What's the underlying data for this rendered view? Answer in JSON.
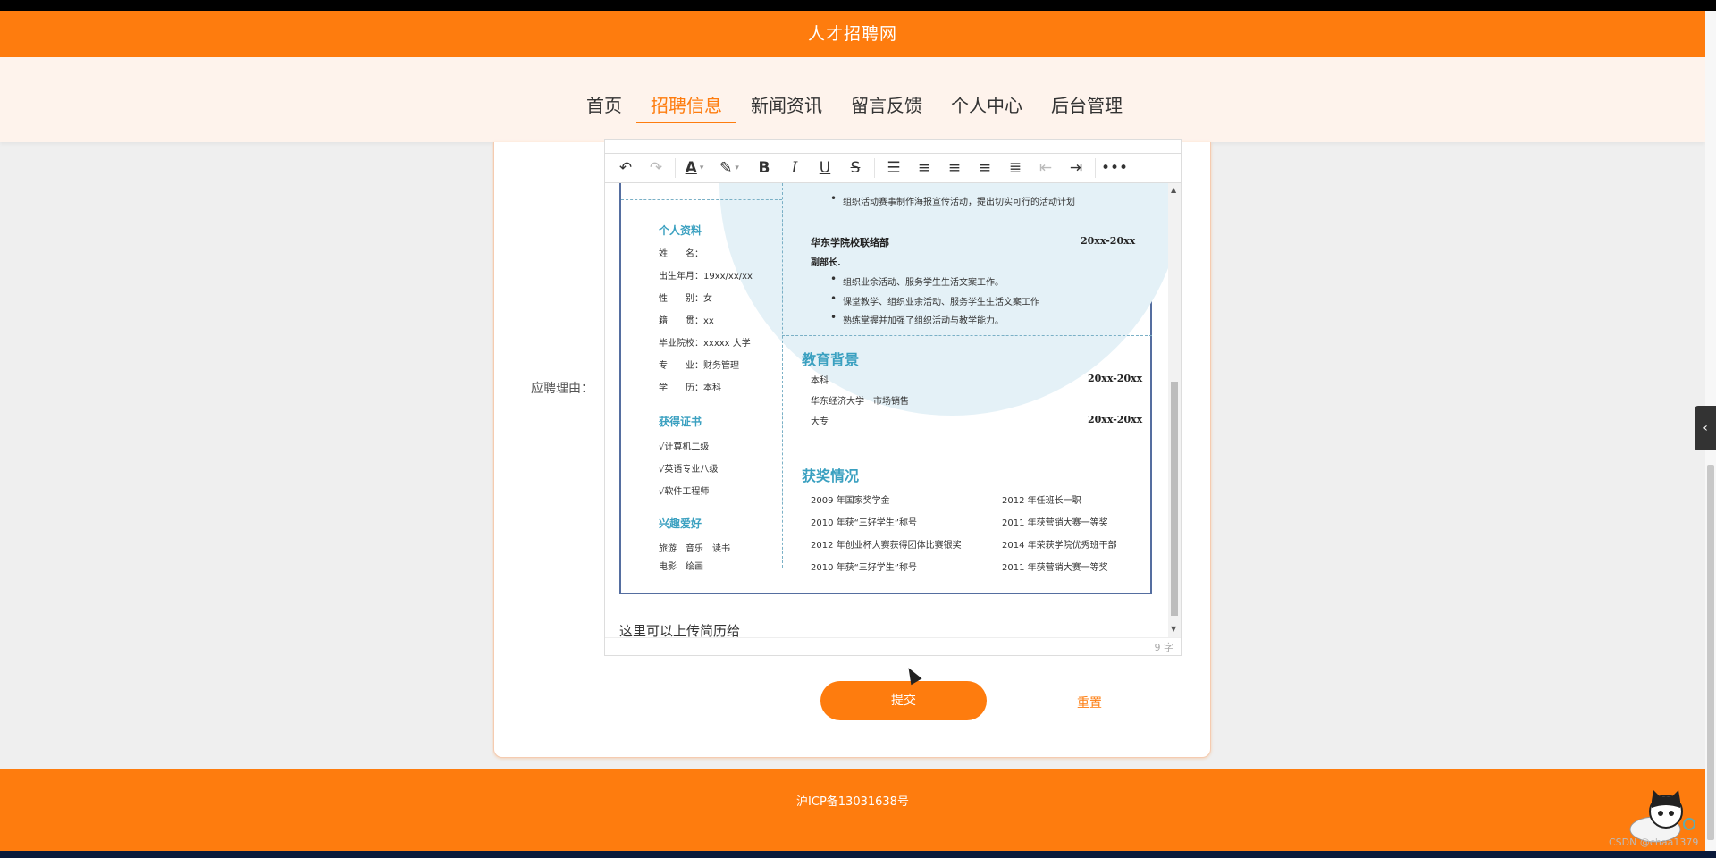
{
  "header": {
    "title": "人才招聘网"
  },
  "nav": {
    "items": [
      "首页",
      "招聘信息",
      "新闻资讯",
      "留言反馈",
      "个人中心",
      "后台管理"
    ],
    "active": "招聘信息"
  },
  "form": {
    "reason_label": "应聘理由：",
    "hint": "这里可以上传简历给",
    "char_count": "9 字",
    "submit_label": "提交",
    "reset_label": "重置"
  },
  "resume": {
    "left": {
      "profile_title": "个人资料",
      "profile": [
        "姓　　名：",
        "出生年月：19xx/xx/xx",
        "性　　别：女",
        "籍　　贯：xx",
        "毕业院校：xxxxx 大学",
        "专　　业：财务管理",
        "学　　历：本科"
      ],
      "cert_title": "获得证书",
      "certs": [
        "√计算机二级",
        "√英语专业八级",
        "√软件工程师"
      ],
      "hobby_title": "兴趣爱好",
      "hobbies_line1": "旅游　音乐　读书",
      "hobbies_line2": "电影　绘画"
    },
    "right": {
      "top_bullet": "组织活动赛事制作海报宣传活动，提出切实可行的活动计划",
      "org": "华东学院校联络部",
      "org_date": "20xx-20xx",
      "role": "副部长.",
      "bullets": [
        "组织业余活动、服务学生生活文案工作。",
        "课堂教学、组织业余活动、服务学生生活文案工作",
        "熟练掌握并加强了组织活动与教学能力。"
      ],
      "edu_title": "教育背景",
      "edu1": "本科",
      "edu1_date": "20xx-20xx",
      "edu_school": "华东经济大学　市场销售",
      "edu2": "大专",
      "edu2_date": "20xx-20xx",
      "award_title": "获奖情况",
      "awards": [
        [
          "2009 年国家奖学金",
          "2012 年任班长一职"
        ],
        [
          "2010 年获“三好学生”称号",
          "2011 年获营销大赛一等奖"
        ],
        [
          "2012 年创业杯大赛获得团体比赛银奖",
          "2014 年荣获学院优秀班干部"
        ],
        [
          "2010 年获“三好学生”称号",
          "2011 年获营销大赛一等奖"
        ]
      ]
    }
  },
  "footer": {
    "icp": "沪ICP备13031638号"
  },
  "watermark": "CSDN @chaa1379",
  "colors": {
    "brand": "#fe7c0e",
    "nav_bg": "#fef3ec",
    "resume_accent": "#3aa0c0"
  },
  "icons": [
    "undo-icon",
    "redo-icon",
    "font-color-icon",
    "highlight-icon",
    "bold-icon",
    "italic-icon",
    "underline-icon",
    "strike-icon",
    "line-height-icon",
    "align-left-icon",
    "align-center-icon",
    "align-right-icon",
    "justify-icon",
    "outdent-icon",
    "indent-icon",
    "more-icon"
  ]
}
